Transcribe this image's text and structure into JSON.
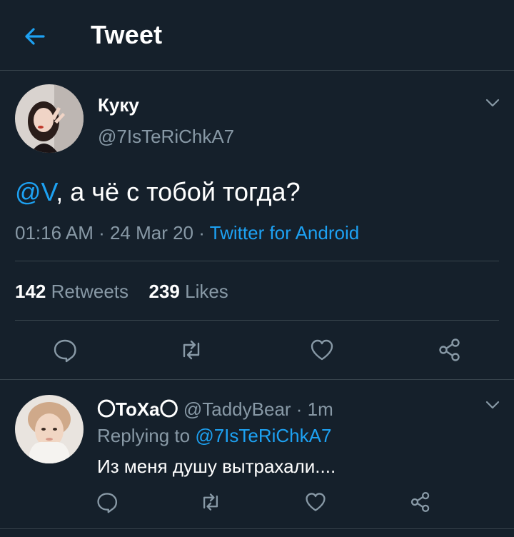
{
  "header": {
    "title": "Tweet",
    "back_icon": "arrow-left-icon",
    "accent": "#1da1f2"
  },
  "tweet": {
    "author_name": "Куку",
    "author_handle": "@7IsTeRiChkA7",
    "mention": "@V",
    "text_rest": ", а чё с тобой тогда?",
    "time": "01:16 AM · 24 Mar 20 · ",
    "source": "Twitter for Android",
    "retweets_count": "142",
    "retweets_label": "Retweets",
    "likes_count": "239",
    "likes_label": "Likes",
    "actions": [
      "reply-icon",
      "retweet-icon",
      "like-icon",
      "share-icon"
    ]
  },
  "reply": {
    "author_name": "〇ToXa〇",
    "author_handle_time": " @TaddyBear · 1m",
    "replying_prefix": "Replying to ",
    "replying_to": "@7IsTeRiChkA7",
    "text": "Из меня душу вытрахали....",
    "actions": [
      "reply-icon",
      "retweet-icon",
      "like-icon",
      "share-icon"
    ]
  },
  "colors": {
    "background": "#15202b",
    "border": "#38444d",
    "muted": "#8899a6",
    "link": "#1da1f2"
  }
}
